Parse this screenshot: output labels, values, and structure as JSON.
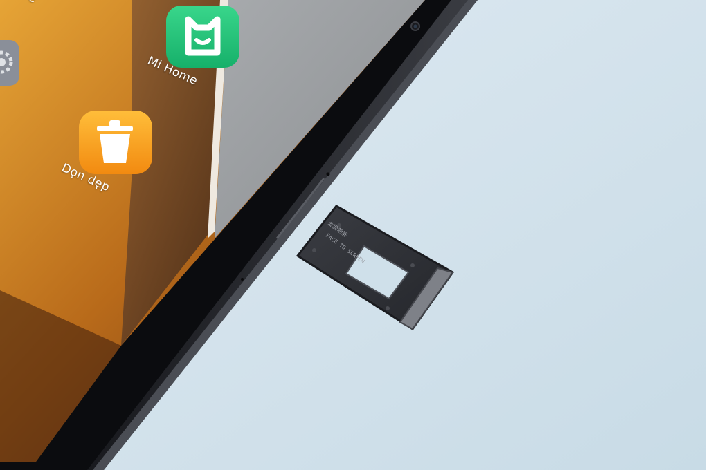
{
  "scene": {
    "description_colors": {
      "table": "#cfe0ea",
      "tablet_frame": "#1d1f24",
      "tablet_bezel": "#0a0b0d",
      "wallpaper_warm": "#c0701a",
      "wallpaper_grey": "#9a9da0",
      "sim_tray": "#2c2e33"
    }
  },
  "apps": {
    "mi_home": {
      "label": "Mi Home",
      "icon": "mi-home-icon",
      "color": "#22c47a"
    },
    "cleaner": {
      "label": "Dọn dẹp",
      "icon": "trash-icon",
      "color": "#f5a21a"
    },
    "settings": {
      "icon": "gear-icon",
      "color": "#8a8f99"
    },
    "top_label": "e"
  },
  "sim_tray": {
    "engraving_line1": "此面朝屏",
    "engraving_line2": "FACE TO SCREEN"
  }
}
